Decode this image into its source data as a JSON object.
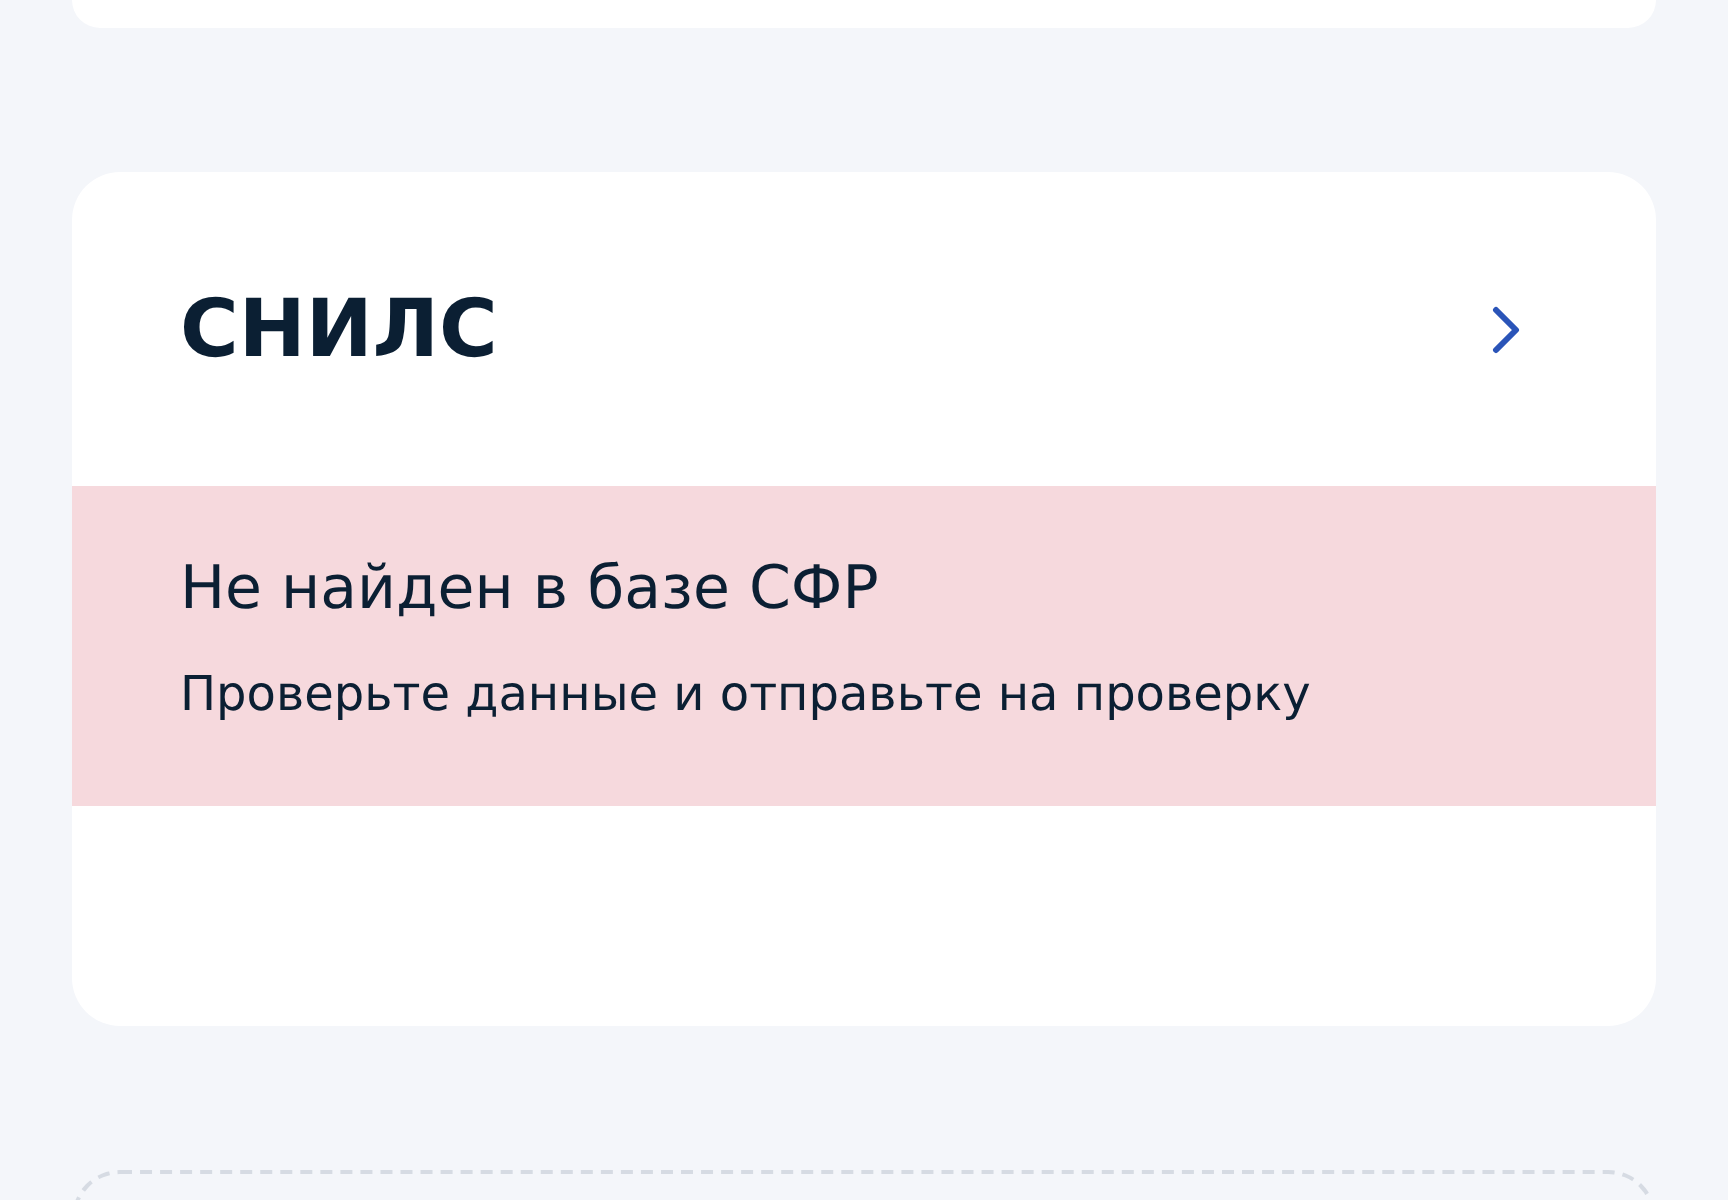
{
  "snils_card": {
    "title": "СНИЛС",
    "status": {
      "title": "Не найден в базе СФР",
      "message": "Проверьте данные и отправьте на проверку"
    }
  }
}
